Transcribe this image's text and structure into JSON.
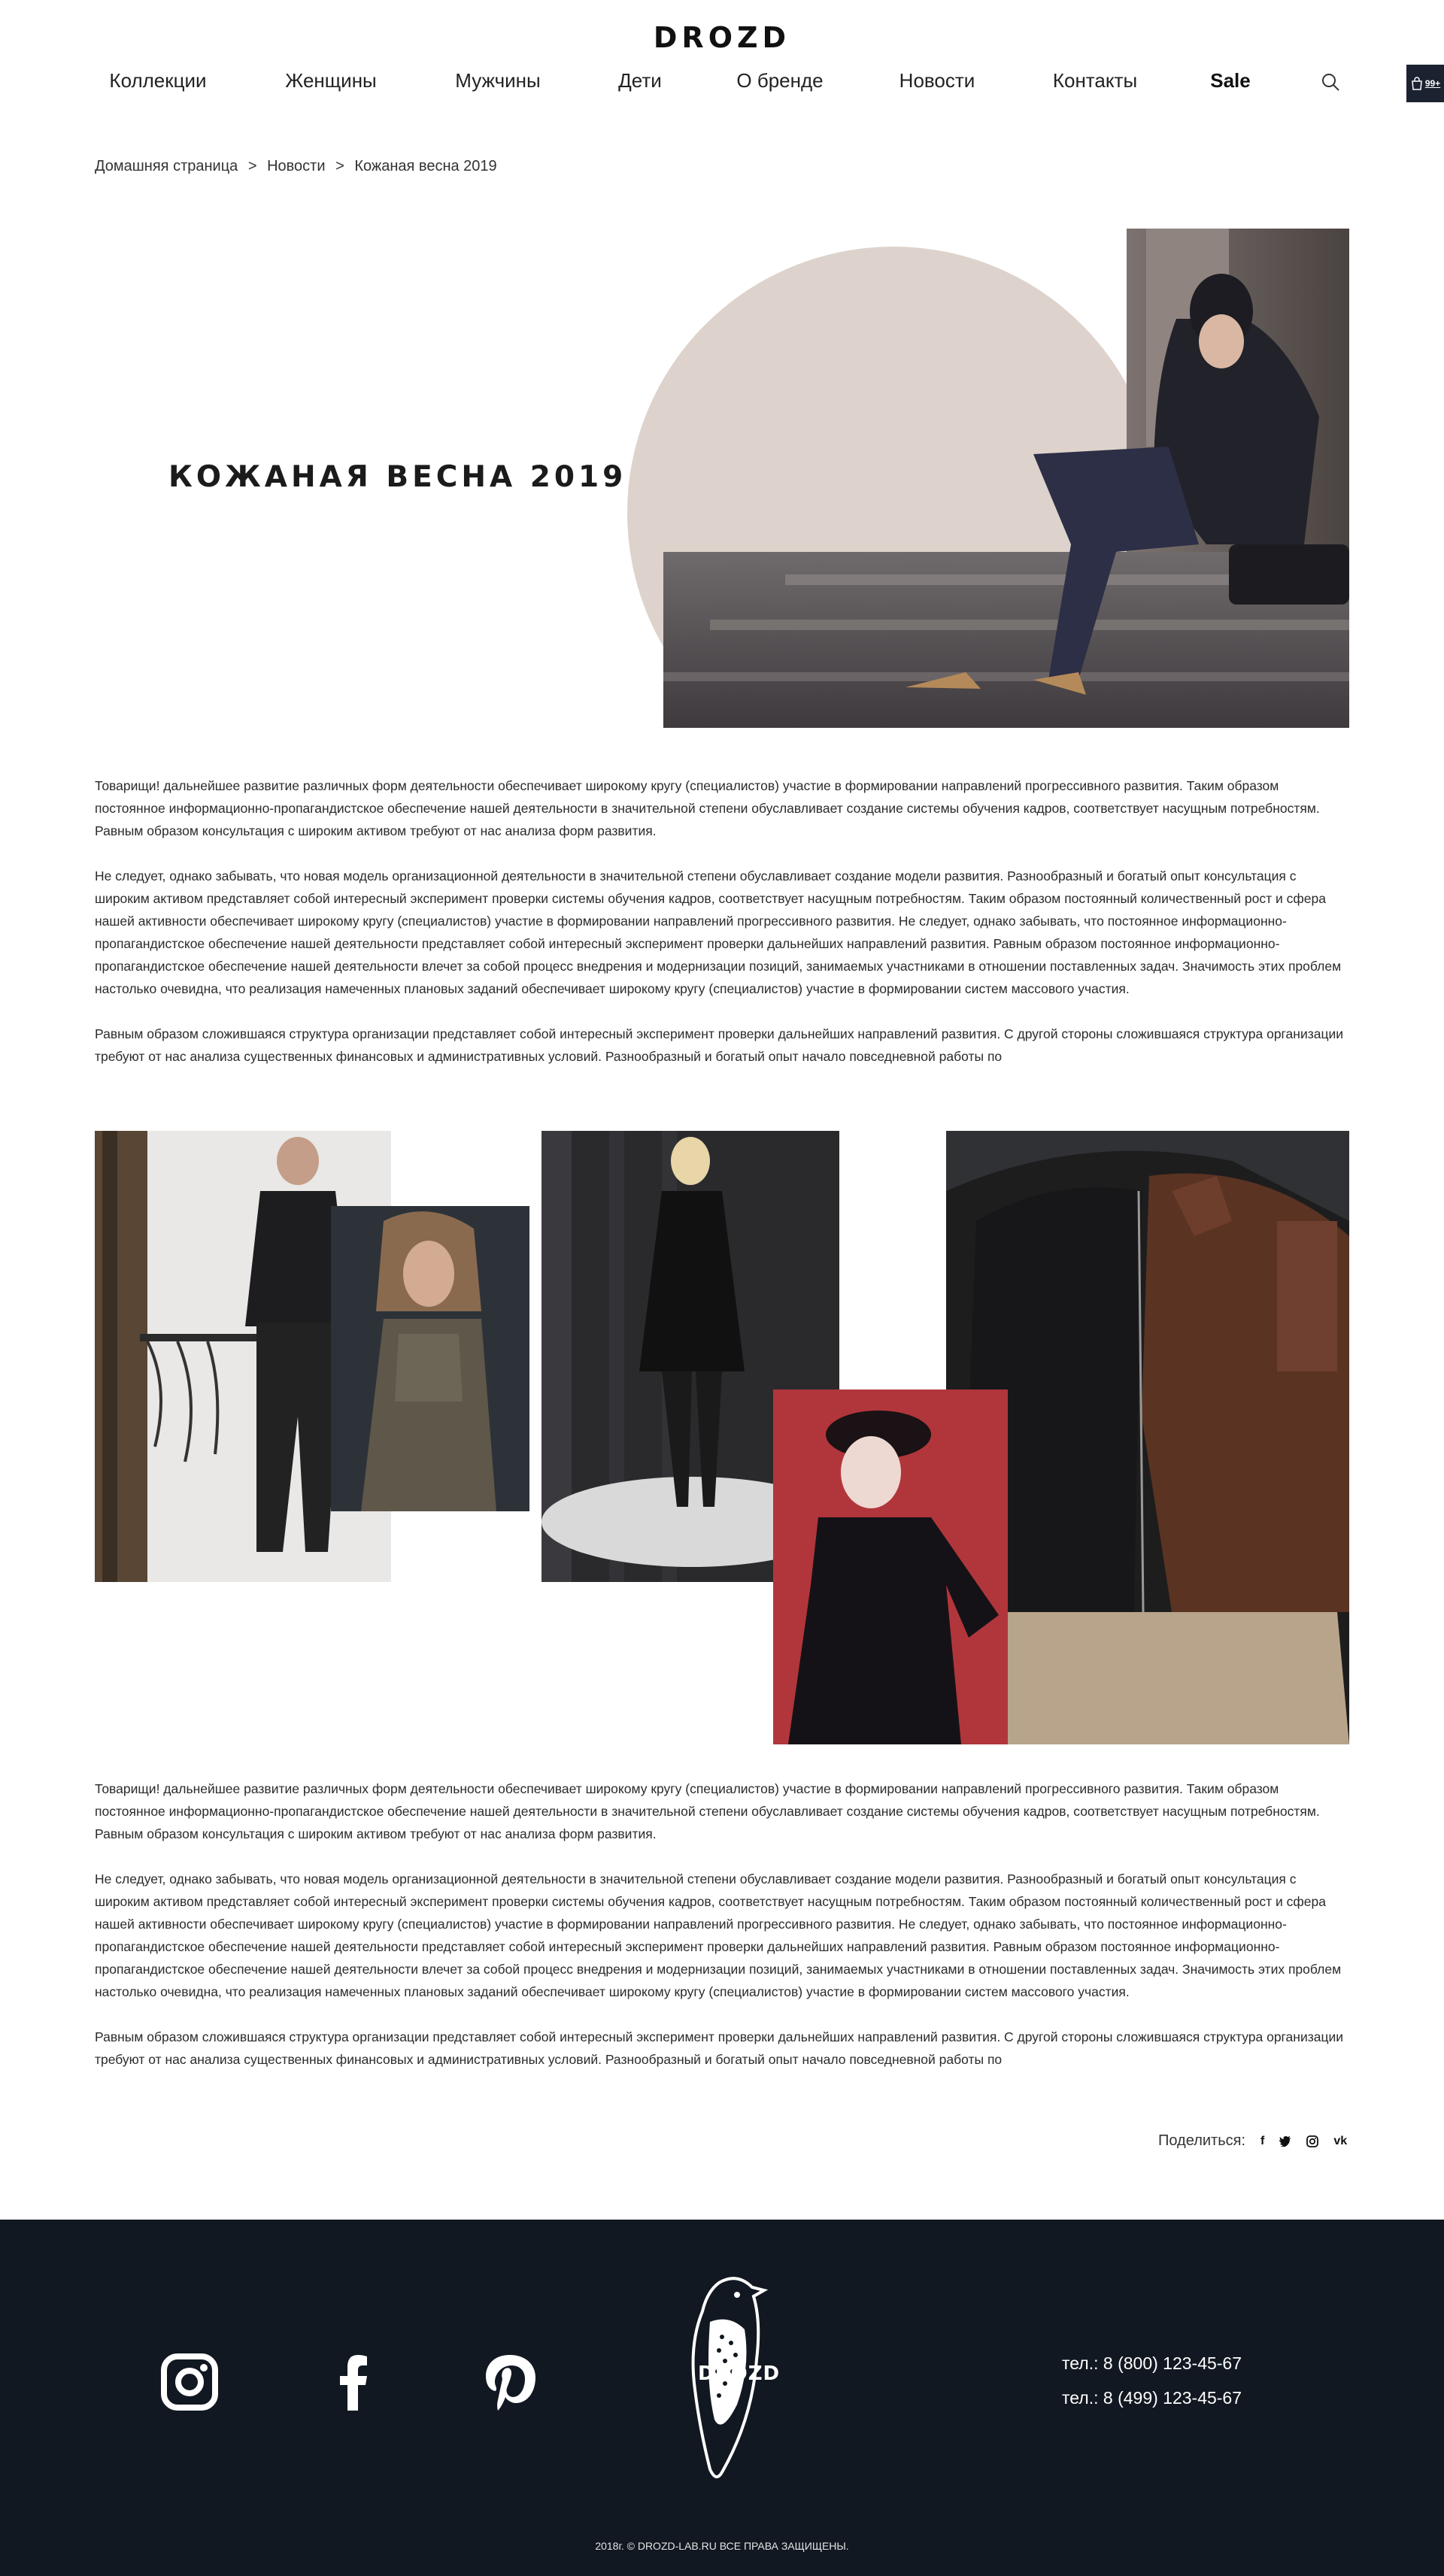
{
  "header": {
    "logo": "DROZD",
    "nav": [
      {
        "label": "Коллекции"
      },
      {
        "label": "Женщины"
      },
      {
        "label": "Мужчины"
      },
      {
        "label": "Дети"
      },
      {
        "label": "О бренде"
      },
      {
        "label": "Новости"
      },
      {
        "label": "Контакты"
      },
      {
        "label": "Sale"
      }
    ],
    "cart_badge": "99+"
  },
  "breadcrumb": {
    "home": "Домашняя страница",
    "section": "Новости",
    "current": "Кожаная весна 2019",
    "separator": ">"
  },
  "article": {
    "title": "КОЖАНАЯ ВЕСНА 2019",
    "paragraphs_top": [
      "Товарищи! дальнейшее развитие различных форм деятельности обеспечивает широкому кругу (специалистов) участие в формировании направлений прогрессивного развития. Таким образом постоянное информационно-пропагандистское обеспечение нашей деятельности в значительной степени обуславливает создание системы обучения кадров, соответствует насущным потребностям. Равным образом консультация с широким активом требуют от нас анализа форм развития.",
      "Не следует, однако забывать, что новая модель организационной деятельности в значительной степени обуславливает создание модели развития. Разнообразный и богатый опыт консультация с широким активом представляет собой интересный эксперимент проверки системы обучения кадров, соответствует насущным потребностям. Таким образом постоянный количественный рост и сфера нашей активности обеспечивает широкому кругу (специалистов) участие в формировании направлений прогрессивного развития. Не следует, однако забывать, что постоянное информационно-пропагандистское обеспечение нашей деятельности представляет собой интересный эксперимент проверки дальнейших направлений развития. Равным образом постоянное информационно-пропагандистское обеспечение нашей деятельности влечет за собой процесс внедрения и модернизации позиций, занимаемых участниками в отношении поставленных задач. Значимость этих проблем настолько очевидна, что реализация намеченных плановых заданий обеспечивает широкому кругу (специалистов) участие в формировании систем массового участия.",
      "Равным образом сложившаяся структура организации представляет собой интересный эксперимент проверки дальнейших направлений развития. С другой стороны сложившаяся структура организации требуют от нас анализа существенных финансовых и административных условий. Разнообразный и богатый опыт начало повседневной работы по"
    ],
    "paragraphs_bottom": [
      "Товарищи! дальнейшее развитие различных форм деятельности обеспечивает широкому кругу (специалистов) участие в формировании направлений прогрессивного развития. Таким образом постоянное информационно-пропагандистское обеспечение нашей деятельности в значительной степени обуславливает создание системы обучения кадров, соответствует насущным потребностям. Равным образом консультация с широким активом требуют от нас анализа форм развития.",
      "Не следует, однако забывать, что новая модель организационной деятельности в значительной степени обуславливает создание модели развития. Разнообразный и богатый опыт консультация с широким активом представляет собой интересный эксперимент проверки системы обучения кадров, соответствует насущным потребностям. Таким образом постоянный количественный рост и сфера нашей активности обеспечивает широкому кругу (специалистов) участие в формировании направлений прогрессивного развития. Не следует, однако забывать, что постоянное информационно-пропагандистское обеспечение нашей деятельности представляет собой интересный эксперимент проверки дальнейших направлений развития. Равным образом постоянное информационно-пропагандистское обеспечение нашей деятельности влечет за собой процесс внедрения и модернизации позиций, занимаемых участниками в отношении поставленных задач. Значимость этих проблем настолько очевидна, что реализация намеченных плановых заданий обеспечивает широкому кругу (специалистов) участие в формировании систем массового участия.",
      "Равным образом сложившаяся структура организации представляет собой интересный эксперимент проверки дальнейших направлений развития. С другой стороны сложившаяся структура организации требуют от нас анализа существенных финансовых и административных условий. Разнообразный и богатый опыт начало повседневной работы по"
    ]
  },
  "share": {
    "label": "Поделиться:",
    "icons": [
      "facebook-icon",
      "twitter-icon",
      "instagram-icon",
      "vk-icon"
    ]
  },
  "footer": {
    "logo": "DROZD",
    "social_icons": [
      "instagram-icon",
      "facebook-icon",
      "pinterest-icon"
    ],
    "phones": [
      "тел.: 8 (800) 123-45-67",
      "тел.: 8 (499) 123-45-67"
    ],
    "copyright": "2018г. © DROZD-LAB.RU ВСЕ ПРАВА ЗАЩИЩЕНЫ."
  },
  "colors": {
    "footer_bg": "#111821",
    "hero_circle": "#ddd3cc",
    "cart_bg": "#1b2230"
  }
}
